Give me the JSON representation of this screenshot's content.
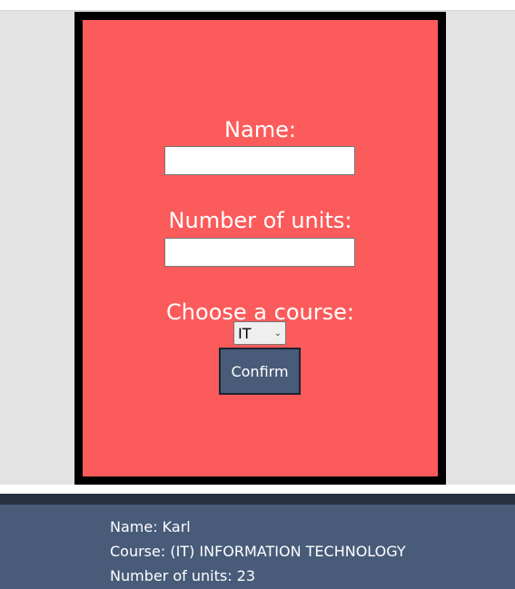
{
  "form": {
    "name_label": "Name:",
    "name_value": "",
    "units_label": "Number of units:",
    "units_value": "",
    "course_label": "Choose a course:",
    "course_selected": "IT",
    "confirm_label": "Confirm"
  },
  "result": {
    "name_line": "Name: Karl",
    "course_line": "Course: (IT) INFORMATION TECHNOLOGY",
    "units_line": "Number of units: 23"
  },
  "colors": {
    "form_background": "#fc5b5b",
    "form_border": "#000000",
    "button_background": "#485b79",
    "result_background": "#485b79",
    "result_top_bar": "#27303e",
    "page_gray": "#e3e3e3"
  },
  "icons": {
    "select_arrow": "chevron-down-icon"
  }
}
